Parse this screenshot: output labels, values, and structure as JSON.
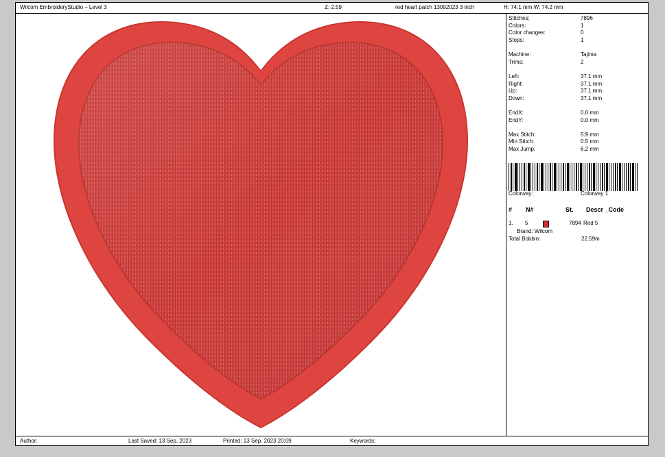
{
  "header": {
    "app_title": "Wilcom EmbroideryStudio – Level 3",
    "zoom": "Z: 2.59",
    "design_name": "red heart patch 13092023 3 inch",
    "dimensions": "H: 74.1 mm   W: 74.2 mm"
  },
  "info": {
    "stitches_label": "Stitches:",
    "stitches": "7896",
    "colors_label": "Colors:",
    "colors": "1",
    "color_changes_label": "Color changes:",
    "color_changes": "0",
    "stops_label": "Stops:",
    "stops": "1",
    "machine_label": "Machine:",
    "machine": "Tajima",
    "trims_label": "Trims:",
    "trims": "2",
    "left_label": "Left:",
    "left": "37.1 mm",
    "right_label": "Right:",
    "right": "37.1 mm",
    "up_label": "Up:",
    "up": "37.1 mm",
    "down_label": "Down:",
    "down": "37.1 mm",
    "endx_label": "EndX:",
    "endx": "0.0 mm",
    "endy_label": "EndY:",
    "endy": "0.0 mm",
    "max_stitch_label": "Max Stitch:",
    "max_stitch": "5.9 mm",
    "min_stitch_label": "Min Stitch:",
    "min_stitch": "0.5 mm",
    "max_jump_label": "Max Jump:",
    "max_jump": "6.2 mm",
    "colorway_label": "Colorway:",
    "colorway": "Colorway 1"
  },
  "color_table": {
    "headers": [
      "#",
      "N#",
      "St.",
      "Descr _Code"
    ],
    "rows": [
      {
        "index": "1.",
        "n": "5",
        "swatch_color": "#e02828",
        "stitches": "7894",
        "descr": "Red 5",
        "brand": "Brand: Wilcom"
      }
    ],
    "total_bobbin_label": "Total Bobbin:",
    "total_bobbin": "22.59m"
  },
  "footer": {
    "author": "Author:",
    "last_saved": "Last Saved: 13 Sep, 2023",
    "printed": "Printed: 13 Sep, 2023 20:09",
    "keywords": "Keywords:"
  },
  "colors": {
    "heart_fill": "#d2423f",
    "heart_border": "#e2453f",
    "page_bg": "#c9c9c9"
  }
}
